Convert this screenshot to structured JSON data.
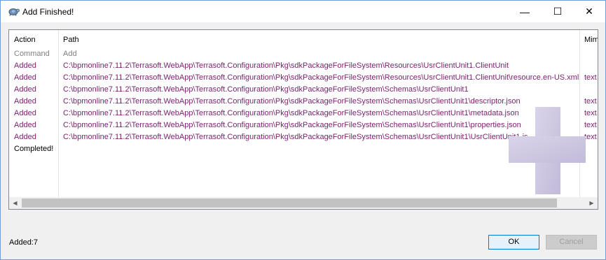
{
  "window": {
    "title": "Add Finished!",
    "controls": {
      "minimize": "—",
      "maximize": "☐",
      "close": "✕"
    }
  },
  "list": {
    "columns": [
      "Action",
      "Path",
      "Mime"
    ],
    "rows": [
      {
        "action": "Command",
        "path": "Add",
        "mime": "",
        "style": "gray"
      },
      {
        "action": "Added",
        "path": "C:\\bpmonline7.11.2\\Terrasoft.WebApp\\Terrasoft.Configuration\\Pkg\\sdkPackageForFileSystem\\Resources\\UsrClientUnit1.ClientUnit",
        "mime": "",
        "style": "purple"
      },
      {
        "action": "Added",
        "path": "C:\\bpmonline7.11.2\\Terrasoft.WebApp\\Terrasoft.Configuration\\Pkg\\sdkPackageForFileSystem\\Resources\\UsrClientUnit1.ClientUnit\\resource.en-US.xml",
        "mime": "text",
        "style": "purple"
      },
      {
        "action": "Added",
        "path": "C:\\bpmonline7.11.2\\Terrasoft.WebApp\\Terrasoft.Configuration\\Pkg\\sdkPackageForFileSystem\\Schemas\\UsrClientUnit1",
        "mime": "",
        "style": "purple"
      },
      {
        "action": "Added",
        "path": "C:\\bpmonline7.11.2\\Terrasoft.WebApp\\Terrasoft.Configuration\\Pkg\\sdkPackageForFileSystem\\Schemas\\UsrClientUnit1\\descriptor.json",
        "mime": "text",
        "style": "purple"
      },
      {
        "action": "Added",
        "path": "C:\\bpmonline7.11.2\\Terrasoft.WebApp\\Terrasoft.Configuration\\Pkg\\sdkPackageForFileSystem\\Schemas\\UsrClientUnit1\\metadata.json",
        "mime": "text",
        "style": "purple"
      },
      {
        "action": "Added",
        "path": "C:\\bpmonline7.11.2\\Terrasoft.WebApp\\Terrasoft.Configuration\\Pkg\\sdkPackageForFileSystem\\Schemas\\UsrClientUnit1\\properties.json",
        "mime": "text",
        "style": "purple"
      },
      {
        "action": "Added",
        "path": "C:\\bpmonline7.11.2\\Terrasoft.WebApp\\Terrasoft.Configuration\\Pkg\\sdkPackageForFileSystem\\Schemas\\UsrClientUnit1\\UsrClientUnit1.js",
        "mime": "text",
        "style": "purple"
      },
      {
        "action": "Completed!",
        "path": "",
        "mime": "",
        "style": "black"
      }
    ]
  },
  "status": {
    "text": "Added:7"
  },
  "buttons": {
    "ok": "OK",
    "cancel": "Cancel"
  },
  "colors": {
    "added_text": "#7a1f6e",
    "command_text": "#808080",
    "watermark": "#c9c3dc"
  },
  "icons": {
    "app": "tortoise-icon",
    "watermark": "plus-icon"
  }
}
